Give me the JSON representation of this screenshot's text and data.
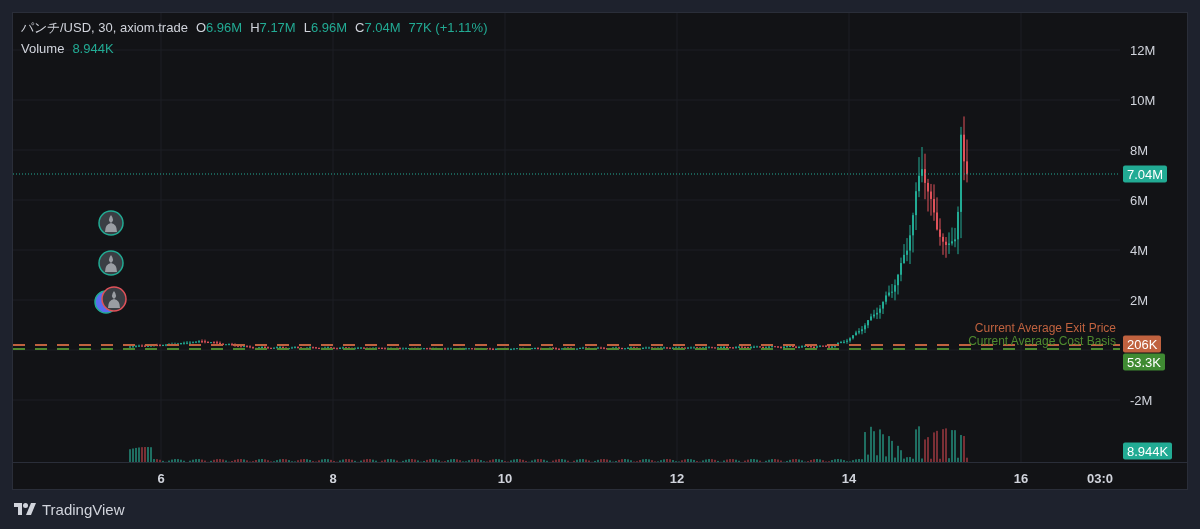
{
  "legend": {
    "symbol": "パンチ/USD, 30, axiom.trade",
    "ohlc": [
      {
        "label": "O",
        "value": "6.96M"
      },
      {
        "label": "H",
        "value": "7.17M"
      },
      {
        "label": "L",
        "value": "6.96M"
      },
      {
        "label": "C",
        "value": "7.04M"
      }
    ],
    "change": "77K (+1.11%)",
    "volume": {
      "label": "Volume",
      "value": "8.944K"
    }
  },
  "price_axis": {
    "ticks": [
      "12M",
      "10M",
      "8M",
      "6M",
      "4M",
      "2M",
      "-2M"
    ]
  },
  "time_axis": {
    "ticks": [
      "6",
      "8",
      "10",
      "12",
      "14",
      "16",
      "03:0"
    ]
  },
  "price_tags": [
    {
      "text": "7.04M",
      "color": "#22ab94"
    },
    {
      "text": "206K",
      "color": "#c0623f"
    },
    {
      "text": "53.3K",
      "color": "#3f8a32"
    },
    {
      "text": "8.944K",
      "color": "#22ab94"
    }
  ],
  "level_lines": [
    {
      "label": "Current Average Exit Price",
      "color": "#c0623f"
    },
    {
      "label": "Current Average Cost Basis",
      "color": "#4f8a2f"
    }
  ],
  "markers": [
    {
      "color": "#22ab94"
    },
    {
      "color": "#22ab94"
    },
    {
      "color": "#e0525a"
    }
  ],
  "footer": {
    "brand": "TradingView"
  }
}
